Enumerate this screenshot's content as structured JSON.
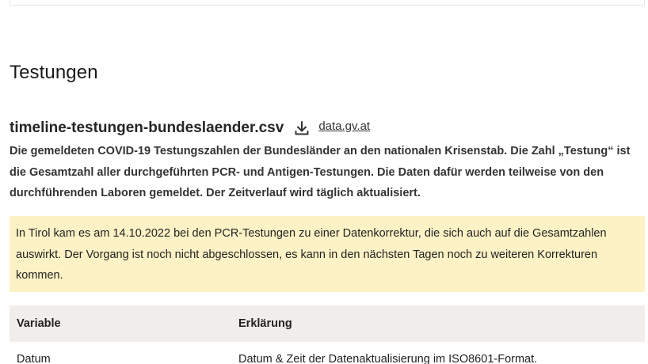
{
  "section": {
    "title": "Testungen"
  },
  "file": {
    "name": "timeline-testungen-bundeslaender.csv",
    "download_icon": "download-icon",
    "source_label": "data.gv.at"
  },
  "description": "Die gemeldeten COVID-19 Testungszahlen der Bundesländer an den nationalen Krisenstab. Die Zahl „Testung“ ist die Gesamtzahl aller durchgeführten PCR- und Antigen-Testungen. Die Daten dafür werden teilweise von den durchführenden Laboren gemeldet. Der Zeitverlauf wird täglich aktualisiert.",
  "notice": {
    "text": "In Tirol kam es am 14.10.2022 bei den PCR-Testungen zu einer Datenkorrektur, die sich auch auf die Gesamtzahlen auswirkt. Der Vorgang ist noch nicht abgeschlossen, es kann in den nächsten Tagen noch zu weiteren Korrekturen kommen.",
    "background": "#fdf2c5"
  },
  "table": {
    "headers": {
      "variable": "Variable",
      "explanation": "Erklärung"
    },
    "rows": [
      {
        "variable": "Datum",
        "explanation": "Datum & Zeit der Datenaktualisierung im ISO8601-Format."
      }
    ]
  }
}
